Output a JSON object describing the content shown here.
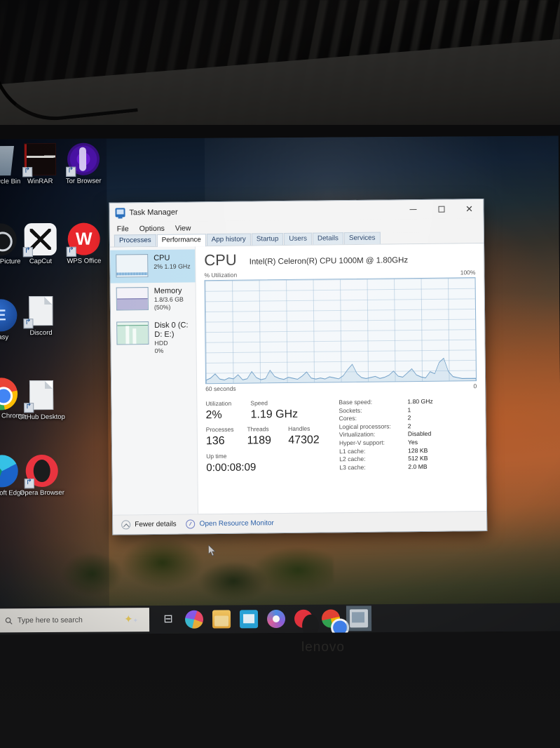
{
  "window": {
    "title": "Task Manager",
    "icon": "task-manager-icon",
    "controls": {
      "minimize": "–",
      "maximize": "□",
      "close": "✕"
    },
    "menu": [
      "File",
      "Options",
      "View"
    ],
    "tabs": [
      {
        "label": "Processes",
        "active": false
      },
      {
        "label": "Performance",
        "active": true
      },
      {
        "label": "App history",
        "active": false
      },
      {
        "label": "Startup",
        "active": false
      },
      {
        "label": "Users",
        "active": false
      },
      {
        "label": "Details",
        "active": false
      },
      {
        "label": "Services",
        "active": false
      }
    ]
  },
  "sidebar": {
    "items": [
      {
        "name": "CPU",
        "detail": "2% 1.19 GHz",
        "detail2": "",
        "selected": true
      },
      {
        "name": "Memory",
        "detail": "1.8/3.6 GB (50%)",
        "detail2": "",
        "selected": false
      },
      {
        "name": "Disk 0 (C: D: E:)",
        "detail": "HDD",
        "detail2": "0%",
        "selected": false
      }
    ]
  },
  "main": {
    "heading": "CPU",
    "model": "Intel(R) Celeron(R) CPU 1000M @ 1.80GHz",
    "graph_title": "% Utilization",
    "graph_max": "100%",
    "graph_left_label": "60 seconds",
    "graph_right_label": "0",
    "stats": [
      {
        "caption": "Utilization",
        "value": "2%"
      },
      {
        "caption": "Speed",
        "value": "1.19 GHz"
      },
      {
        "caption": "Processes",
        "value": "136"
      },
      {
        "caption": "Threads",
        "value": "1189"
      },
      {
        "caption": "Handles",
        "value": "47302"
      },
      {
        "caption": "Up time",
        "value": "0:00:08:09"
      }
    ],
    "specs": [
      {
        "key": "Base speed:",
        "value": "1.80 GHz"
      },
      {
        "key": "Sockets:",
        "value": "1"
      },
      {
        "key": "Cores:",
        "value": "2"
      },
      {
        "key": "Logical processors:",
        "value": "2"
      },
      {
        "key": "Virtualization:",
        "value": "Disabled"
      },
      {
        "key": "Hyper-V support:",
        "value": "Yes"
      },
      {
        "key": "L1 cache:",
        "value": "128 KB"
      },
      {
        "key": "L2 cache:",
        "value": "512 KB"
      },
      {
        "key": "L3 cache:",
        "value": "2.0 MB"
      }
    ]
  },
  "footer": {
    "fewer_details": "Fewer details",
    "resource_monitor": "Open Resource Monitor"
  },
  "desktop": {
    "icons": [
      {
        "label": "Recycle Bin",
        "icon": "recycle-bin-icon",
        "shortcut": false
      },
      {
        "label": "WinRAR",
        "icon": "winrar-icon",
        "shortcut": true
      },
      {
        "label": "Tor Browser",
        "icon": "tor-browser-icon",
        "shortcut": true
      },
      {
        "label": "About Picture",
        "icon": "document-icon",
        "shortcut": true
      },
      {
        "label": "CapCut",
        "icon": "capcut-icon",
        "shortcut": true
      },
      {
        "label": "WPS Office",
        "icon": "wps-office-icon",
        "shortcut": true
      },
      {
        "label": "Easy",
        "icon": "blue-app-icon",
        "shortcut": true
      },
      {
        "label": "Discord",
        "icon": "document-icon",
        "shortcut": true
      },
      {
        "label": "Google Chrome",
        "icon": "chrome-icon",
        "shortcut": true
      },
      {
        "label": "GitHub Desktop",
        "icon": "document-icon",
        "shortcut": true
      },
      {
        "label": "Microsoft Edge",
        "icon": "edge-icon",
        "shortcut": true
      },
      {
        "label": "Opera Browser",
        "icon": "opera-icon",
        "shortcut": true
      }
    ]
  },
  "taskbar": {
    "search_placeholder": "Type here to search",
    "items": [
      {
        "name": "task-view-icon",
        "glyph": "⊟"
      },
      {
        "name": "copilot-icon",
        "glyph": ""
      },
      {
        "name": "file-explorer-icon",
        "glyph": ""
      },
      {
        "name": "microsoft-store-icon",
        "glyph": ""
      },
      {
        "name": "movies-tv-icon",
        "glyph": ""
      },
      {
        "name": "opera-icon",
        "glyph": ""
      },
      {
        "name": "chrome-icon",
        "glyph": ""
      },
      {
        "name": "task-manager-icon",
        "glyph": ""
      }
    ]
  },
  "device": {
    "brand": "lenovo"
  },
  "chart_data": {
    "type": "line",
    "title": "% Utilization",
    "ylabel": "% Utilization",
    "xlabel": "60 seconds",
    "ylim": [
      0,
      100
    ],
    "x_axis_labels": [
      "60 seconds",
      "0"
    ],
    "y_axis_labels": [
      "100%",
      "0"
    ],
    "grid": true,
    "series": [
      {
        "name": "CPU utilization",
        "values": [
          3,
          5,
          9,
          4,
          3,
          5,
          4,
          8,
          3,
          4,
          11,
          5,
          3,
          4,
          12,
          6,
          4,
          3,
          5,
          4,
          3,
          6,
          10,
          4,
          3,
          4,
          3,
          5,
          4,
          3,
          6,
          12,
          17,
          8,
          4,
          3,
          4,
          5,
          3,
          4,
          6,
          10,
          5,
          4,
          8,
          12,
          6,
          4,
          3,
          9,
          7,
          18,
          22,
          9,
          4,
          3,
          2,
          2,
          2,
          2
        ]
      }
    ]
  }
}
